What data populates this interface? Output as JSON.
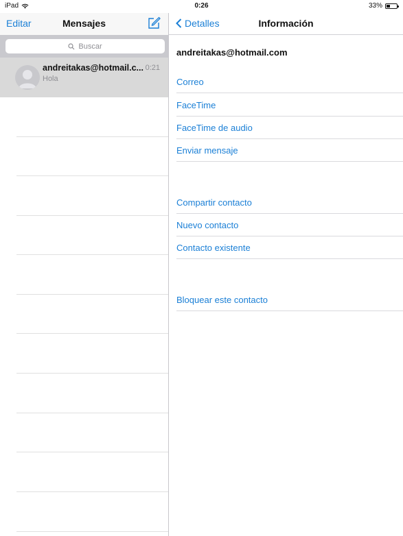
{
  "status_bar": {
    "device": "iPad",
    "time": "0:26",
    "battery": "33%",
    "battery_level": 0.33
  },
  "left": {
    "edit_label": "Editar",
    "title": "Mensajes",
    "search_placeholder": "Buscar",
    "conversation": {
      "name": "andreitakas@hotmail.c...",
      "time": "0:21",
      "preview": "Hola"
    }
  },
  "right": {
    "back_label": "Detalles",
    "title": "Información",
    "email": "andreitakas@hotmail.com",
    "group1": [
      "Correo",
      "FaceTime",
      "FaceTime de audio",
      "Enviar mensaje"
    ],
    "group2": [
      "Compartir contacto",
      "Nuevo contacto",
      "Contacto existente"
    ],
    "group3": [
      "Bloquear este contacto"
    ]
  },
  "colors": {
    "accent": "#1a7fd6",
    "separator": "#d9d9dd"
  }
}
